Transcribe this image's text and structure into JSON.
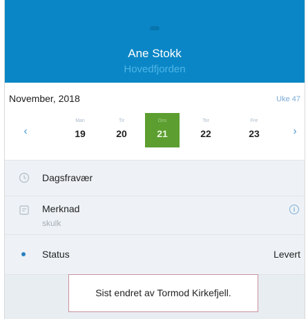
{
  "header": {
    "name": "Ane Stokk",
    "place": "Hovedfjorden"
  },
  "calendar": {
    "month": "November, 2018",
    "week": "Uke 47",
    "prev_icon": "chevron-left-icon",
    "next_icon": "chevron-right-icon",
    "days": [
      {
        "dow": "Man",
        "date": "19"
      },
      {
        "dow": "Tir",
        "date": "20"
      },
      {
        "dow": "Ons",
        "date": "21",
        "selected": true
      },
      {
        "dow": "Tor",
        "date": "22"
      },
      {
        "dow": "Fre",
        "date": "23"
      }
    ]
  },
  "rows": {
    "absence": {
      "label": "Dagsfravær",
      "icon": "clock-icon"
    },
    "note": {
      "label": "Merknad",
      "value": "skulk",
      "icon": "note-icon",
      "info_icon": "info-icon"
    },
    "status": {
      "label": "Status",
      "value": "Levert",
      "icon": "status-dot-icon"
    }
  },
  "toast": {
    "text": "Sist endret av Tormod Kirkefjell."
  },
  "colors": {
    "header": "#0a86c6",
    "selected_day": "#5c9e30",
    "accent": "#4b9cd8"
  }
}
